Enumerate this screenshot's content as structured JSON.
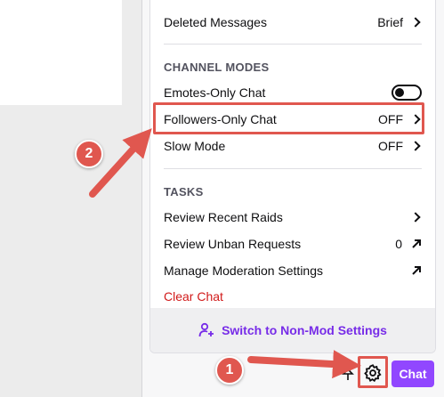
{
  "menu": {
    "top_row": {
      "label": "Deleted Messages",
      "value": "Brief"
    },
    "channel_modes_title": "CHANNEL MODES",
    "channel_modes": [
      {
        "label": "Emotes-Only Chat",
        "value": ""
      },
      {
        "label": "Followers-Only Chat",
        "value": "OFF"
      },
      {
        "label": "Slow Mode",
        "value": "OFF"
      }
    ],
    "tasks_title": "TASKS",
    "tasks": [
      {
        "label": "Review Recent Raids",
        "value": ""
      },
      {
        "label": "Review Unban Requests",
        "value": "0"
      },
      {
        "label": "Manage Moderation Settings",
        "value": ""
      }
    ],
    "clear_chat": "Clear Chat",
    "footer_button": "Switch to Non-Mod Settings"
  },
  "toolbar": {
    "chat_button": "Chat"
  },
  "annotations": {
    "step1": "1",
    "step2": "2"
  },
  "colors": {
    "accent": "#9147ff",
    "annotation": "#e0574f",
    "danger": "#d11a1a"
  },
  "icons": [
    "chevron-right-icon",
    "toggle-switch",
    "arrow-up-right-icon",
    "user-switch-icon",
    "gear-icon",
    "pin-icon"
  ]
}
